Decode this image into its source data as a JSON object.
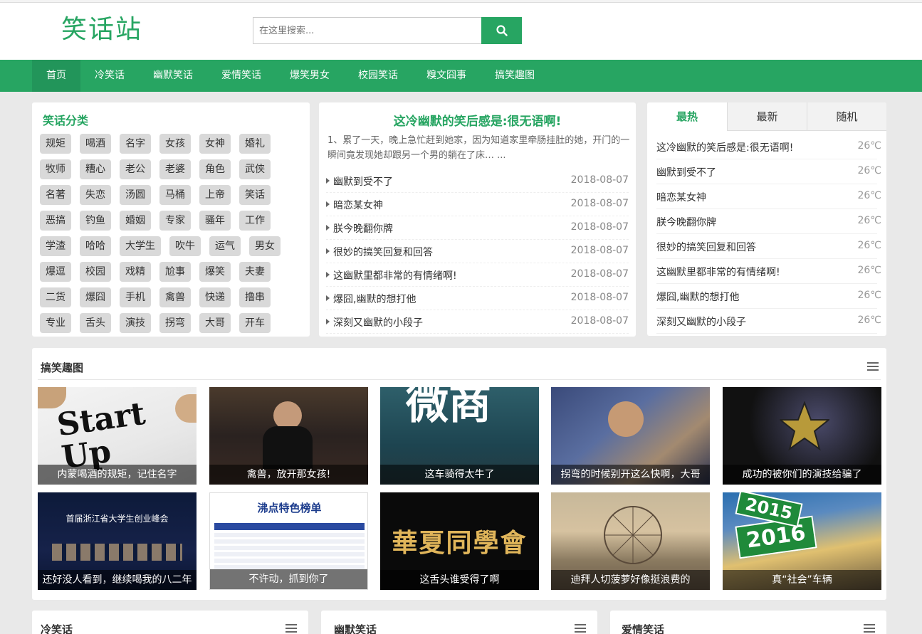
{
  "header": {
    "logo_text": "笑话站",
    "search_placeholder": "在这里搜索..."
  },
  "nav": [
    "首页",
    "冷笑话",
    "幽默笑话",
    "爱情笑话",
    "爆笑男女",
    "校园笑话",
    "糗文囧事",
    "搞笑趣图"
  ],
  "categories": {
    "title": "笑话分类",
    "tags": [
      "规矩",
      "喝酒",
      "名字",
      "女孩",
      "女神",
      "婚礼",
      "牧师",
      "糟心",
      "老公",
      "老婆",
      "角色",
      "武侠",
      "名著",
      "失恋",
      "汤圆",
      "马桶",
      "上帝",
      "笑话",
      "恶搞",
      "钓鱼",
      "婚姻",
      "专家",
      "骚年",
      "工作",
      "学渣",
      "哈哈",
      "大学生",
      "吹牛",
      "运气",
      "男女",
      "爆逗",
      "校园",
      "戏精",
      "尬事",
      "爆笑",
      "夫妻",
      "二货",
      "爆囧",
      "手机",
      "禽兽",
      "快递",
      "撸串",
      "专业",
      "舌头",
      "演技",
      "拐弯",
      "大哥",
      "开车"
    ]
  },
  "featured": {
    "title": "这冷幽默的笑后感是:很无语啊!",
    "desc": "1、累了一天，晚上急忙赶到她家，因为知道家里牵肠挂肚的她，开门的一瞬间竟发现她却跟另一个男的躺在了床… ...",
    "items": [
      {
        "title": "幽默到受不了",
        "date": "2018-08-07"
      },
      {
        "title": "暗恋某女神",
        "date": "2018-08-07"
      },
      {
        "title": "朕今晚翻你牌",
        "date": "2018-08-07"
      },
      {
        "title": "很妙的搞笑回复和回答",
        "date": "2018-08-07"
      },
      {
        "title": "这幽默里都非常的有情绪啊!",
        "date": "2018-08-07"
      },
      {
        "title": "爆囧,幽默的想打他",
        "date": "2018-08-07"
      },
      {
        "title": "深刻又幽默的小段子",
        "date": "2018-08-07"
      }
    ]
  },
  "hot": {
    "tabs": [
      "最热",
      "最新",
      "随机"
    ],
    "items": [
      {
        "title": "这冷幽默的笑后感是:很无语啊!",
        "temp": "26℃"
      },
      {
        "title": "幽默到受不了",
        "temp": "26℃"
      },
      {
        "title": "暗恋某女神",
        "temp": "26℃"
      },
      {
        "title": "朕今晚翻你牌",
        "temp": "26℃"
      },
      {
        "title": "很妙的搞笑回复和回答",
        "temp": "26℃"
      },
      {
        "title": "这幽默里都非常的有情绪啊!",
        "temp": "26℃"
      },
      {
        "title": "爆囧,幽默的想打他",
        "temp": "26℃"
      },
      {
        "title": "深刻又幽默的小段子",
        "temp": "26℃"
      }
    ]
  },
  "pics": {
    "title": "搞笑趣图",
    "items": [
      {
        "caption": "内蒙喝酒的规矩，记住名字",
        "overlay": "Start Up"
      },
      {
        "caption": "禽兽，放开那女孩!",
        "overlay": ""
      },
      {
        "caption": "这车骑得太牛了",
        "overlay": "微商"
      },
      {
        "caption": "拐弯的时候别开这么快啊，大哥",
        "overlay": ""
      },
      {
        "caption": "成功的被你们的演技给骗了",
        "overlay": ""
      },
      {
        "caption": "还好没人看到，继续喝我的八二年",
        "overlay": "首届浙江省大学生创业峰会"
      },
      {
        "caption": "不许动，抓到你了",
        "overlay": "沸点特色榜单"
      },
      {
        "caption": "这舌头谁受得了啊",
        "overlay": "華夏同學會"
      },
      {
        "caption": "迪拜人切菠萝好像挺浪费的",
        "overlay": ""
      },
      {
        "caption": "真“社会”车辆",
        "overlay": "2015 2016"
      }
    ]
  },
  "bottom_sections": [
    "冷笑话",
    "幽默笑话",
    "爱情笑话"
  ],
  "colors": {
    "brand": "#27a562",
    "background": "#e9e9e9"
  }
}
